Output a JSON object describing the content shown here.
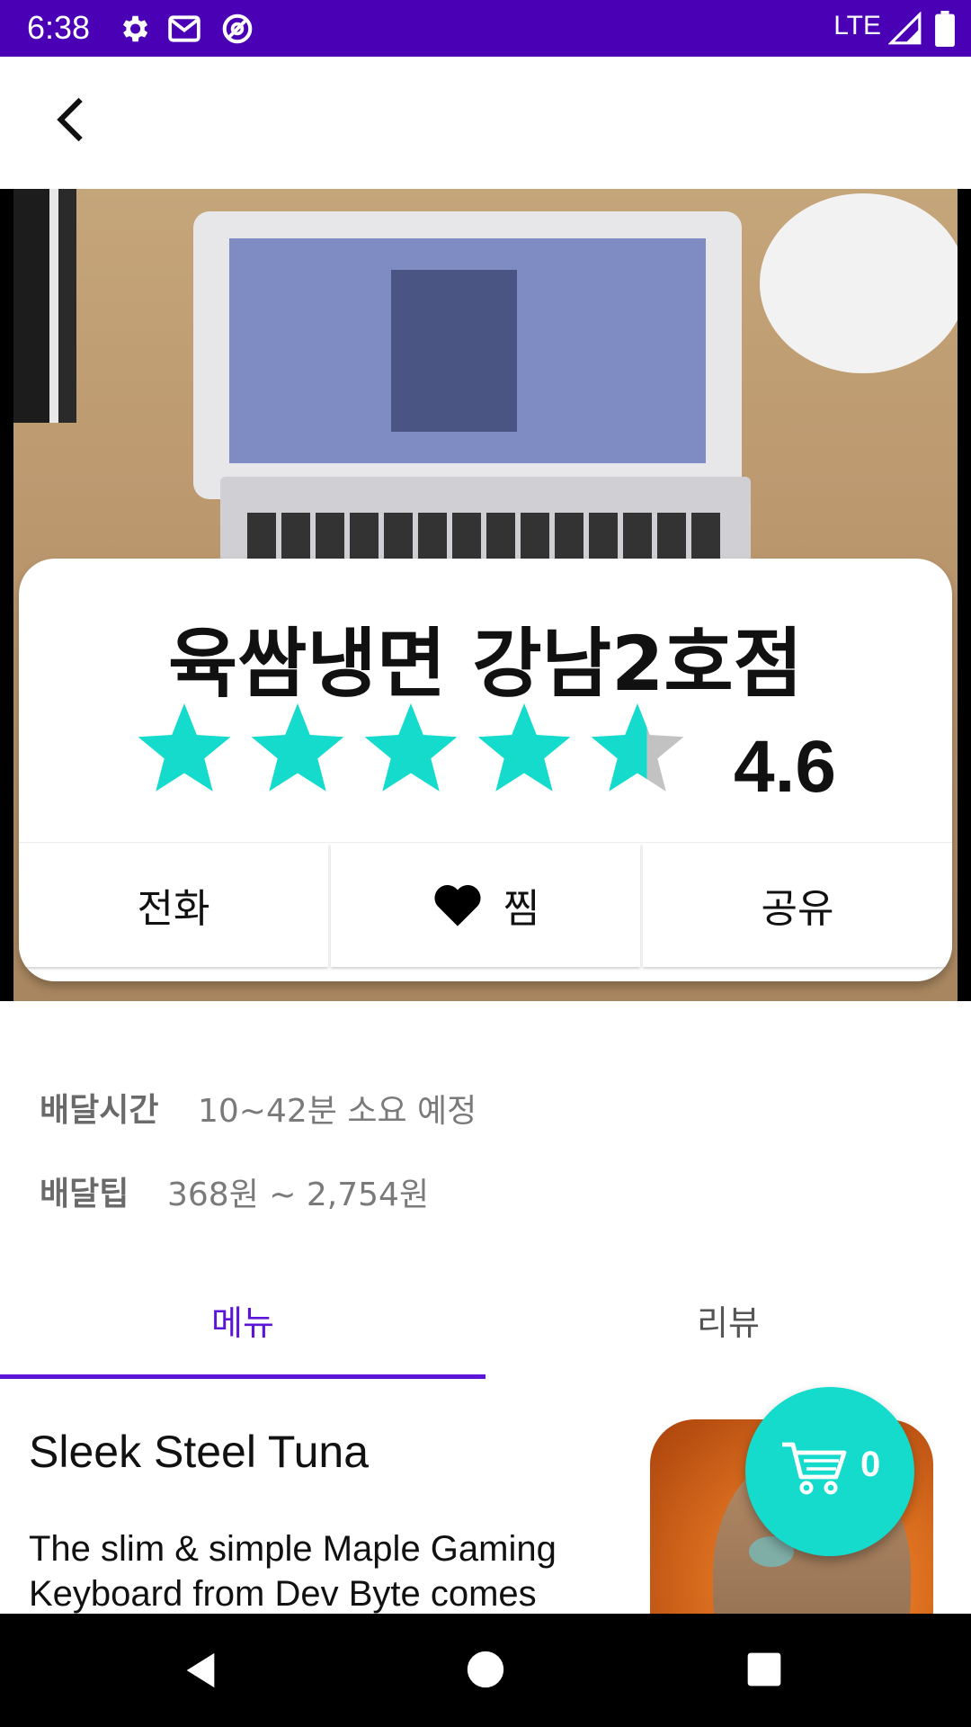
{
  "status_bar": {
    "time": "6:38",
    "network": "LTE"
  },
  "colors": {
    "status_bar": "#4a00b4",
    "accent": "#5b14d8",
    "star": "#14dbcc",
    "star_empty": "#c2c2c2",
    "fab": "#14dbcc"
  },
  "store": {
    "name": "육쌈냉면 강남2호점",
    "rating_value": 4.6,
    "rating_text": "4.6",
    "stars_max": 5
  },
  "actions": {
    "call": "전화",
    "favorite": "찜",
    "share": "공유"
  },
  "delivery": {
    "time_label": "배달시간",
    "time_value": "10~42분 소요 예정",
    "tip_label": "배달팁",
    "tip_value": "368원 ~ 2,754원"
  },
  "tabs": [
    {
      "label": "메뉴",
      "selected": true
    },
    {
      "label": "리뷰",
      "selected": false
    }
  ],
  "menu_item": {
    "name": "Sleek Steel Tuna",
    "description": "The slim & simple Maple Gaming Keyboard from Dev Byte comes"
  },
  "cart": {
    "count": "0"
  },
  "icons": {
    "status": [
      "gear-icon",
      "gmail-icon",
      "at-sign-icon",
      "signal-icon",
      "battery-icon"
    ],
    "back": "back-arrow-icon",
    "favorite": "heart-icon",
    "cart": "cart-icon",
    "nav": [
      "nav-back-icon",
      "nav-home-icon",
      "nav-recents-icon"
    ]
  }
}
